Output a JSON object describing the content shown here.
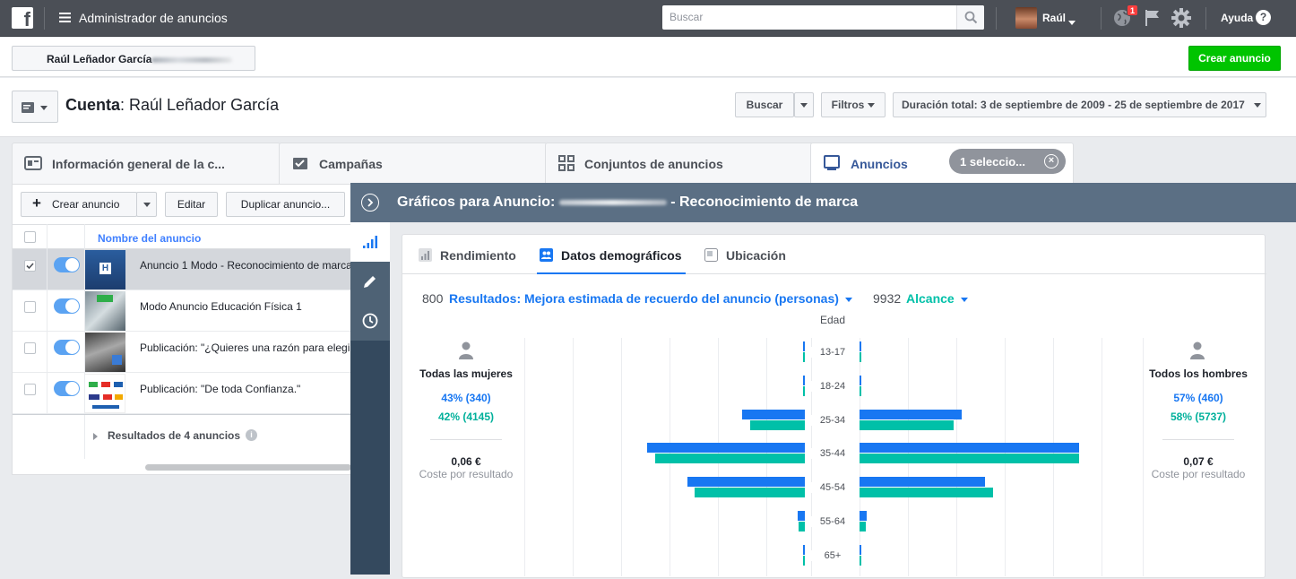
{
  "topbar": {
    "logo": "f",
    "app_title": "Administrador de anuncios",
    "search_placeholder": "Buscar",
    "user_name": "Raúl",
    "notification_count": "1",
    "help_label": "Ayuda",
    "help_glyph": "?"
  },
  "account_strip": {
    "account_name": "Raúl Leñador García",
    "create_ad_label": "Crear anuncio"
  },
  "account_row": {
    "label": "Cuenta",
    "name": ": Raúl Leñador García",
    "search_button": "Buscar",
    "filters_button": "Filtros",
    "date_range": "Duración total: 3 de septiembre de 2009 - 25 de septiembre de 2017"
  },
  "tabs": [
    {
      "label": "Información general de la c...",
      "icon": "account-overview-icon"
    },
    {
      "label": "Campañas",
      "icon": "campaigns-icon"
    },
    {
      "label": "Conjuntos de anuncios",
      "icon": "ad-sets-icon"
    },
    {
      "label": "Anuncios",
      "icon": "ads-icon"
    }
  ],
  "selection_pill": {
    "label": "1 seleccio...",
    "close_glyph": "×"
  },
  "left_panel": {
    "create_button": "Crear anuncio",
    "create_plus": "+",
    "edit_button": "Editar",
    "duplicate_button": "Duplicar anuncio...",
    "column_header": "Nombre del anuncio",
    "rows": [
      {
        "name": "Anuncio 1 Modo - Reconocimiento de marca",
        "selected": true
      },
      {
        "name": "Modo Anuncio Educación Física 1",
        "selected": false
      },
      {
        "name": "Publicación: \"¿Quieres una razón para elegir",
        "selected": false
      },
      {
        "name": "Publicación: \"De toda Confianza.\"",
        "selected": false
      }
    ],
    "results_footer": "Resultados de 4 anuncios",
    "info_glyph": "i"
  },
  "chart_panel": {
    "title_prefix": "Gráficos para Anuncio: ",
    "title_suffix": " - Reconocimiento de marca",
    "sub_tabs": [
      "Rendimiento",
      "Datos demográficos",
      "Ubicación"
    ],
    "active_sub_tab": "Datos demográficos",
    "results_count": "800",
    "results_metric": "Resultados: Mejora estimada de recuerdo del anuncio (personas)",
    "reach_count": "9932",
    "reach_metric": "Alcance",
    "women": {
      "label": "Todas las mujeres",
      "results_pct": "43% (340)",
      "reach_pct": "42% (4145)",
      "cost": "0,06 €",
      "cost_label": "Coste por resultado"
    },
    "men": {
      "label": "Todos los hombres",
      "results_pct": "57% (460)",
      "reach_pct": "58% (5737)",
      "cost": "0,07 €",
      "cost_label": "Coste por resultado"
    }
  },
  "chart_data": {
    "type": "bar",
    "title": "Edad",
    "categories": [
      "13-17",
      "18-24",
      "25-34",
      "35-44",
      "45-54",
      "55-64",
      "65+"
    ],
    "series": [
      {
        "name": "Resultados",
        "side": "mujeres",
        "values": [
          1,
          1,
          75,
          188,
          140,
          9,
          1
        ]
      },
      {
        "name": "Alcance",
        "side": "mujeres",
        "values": [
          1,
          1,
          65,
          178,
          131,
          8,
          1
        ]
      },
      {
        "name": "Resultados",
        "side": "hombres",
        "values": [
          1,
          1,
          122,
          262,
          150,
          9,
          1
        ]
      },
      {
        "name": "Alcance",
        "side": "hombres",
        "values": [
          1,
          1,
          112,
          262,
          159,
          8,
          1
        ]
      }
    ],
    "colors": {
      "results": "#1877f2",
      "reach": "#00c0a8"
    },
    "xlim": [
      0,
      280
    ]
  },
  "colors": {
    "topbar": "#4b4f56",
    "link_blue": "#365899",
    "green_button": "#00c400",
    "panel_header": "#5b6f84",
    "rail": "#34495e"
  }
}
